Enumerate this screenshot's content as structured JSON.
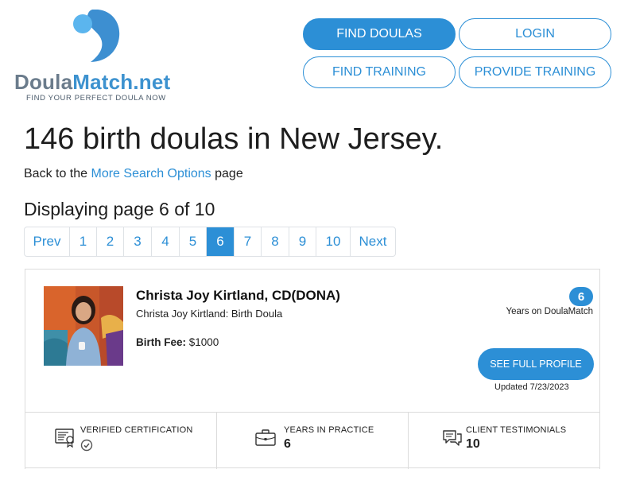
{
  "logo": {
    "word_part1": "Doula",
    "word_part2": "Match.net",
    "tagline": "FIND YOUR PERFECT DOULA NOW"
  },
  "nav": {
    "find_doulas": "FIND DOULAS",
    "login": "LOGIN",
    "find_training": "FIND TRAINING",
    "provide_training": "PROVIDE TRAINING"
  },
  "page": {
    "title": "146 birth doulas in New Jersey.",
    "back_prefix": "Back to the ",
    "back_link": "More Search Options",
    "back_suffix": " page",
    "displaying": "Displaying page 6 of 10"
  },
  "pagination": {
    "prev": "Prev",
    "pages": [
      "1",
      "2",
      "3",
      "4",
      "5",
      "6",
      "7",
      "8",
      "9",
      "10"
    ],
    "next": "Next",
    "current": "6"
  },
  "card": {
    "name": "Christa Joy Kirtland, CD(DONA)",
    "subtitle": "Christa Joy Kirtland: Birth Doula",
    "fee_label": "Birth Fee:",
    "fee_value": " $1000",
    "years_count": "6",
    "years_label": "Years on DoulaMatch",
    "profile_button": "SEE FULL PROFILE",
    "updated": "Updated 7/23/2023"
  },
  "stats": {
    "certification_label": "VERIFIED CERTIFICATION",
    "years_label": "YEARS IN PRACTICE",
    "years_value": "6",
    "testimonials_label": "CLIENT TESTIMONIALS",
    "testimonials_value": "10"
  },
  "colors": {
    "accent": "#2c8fd6",
    "logo_gray": "#6b7c8c"
  }
}
